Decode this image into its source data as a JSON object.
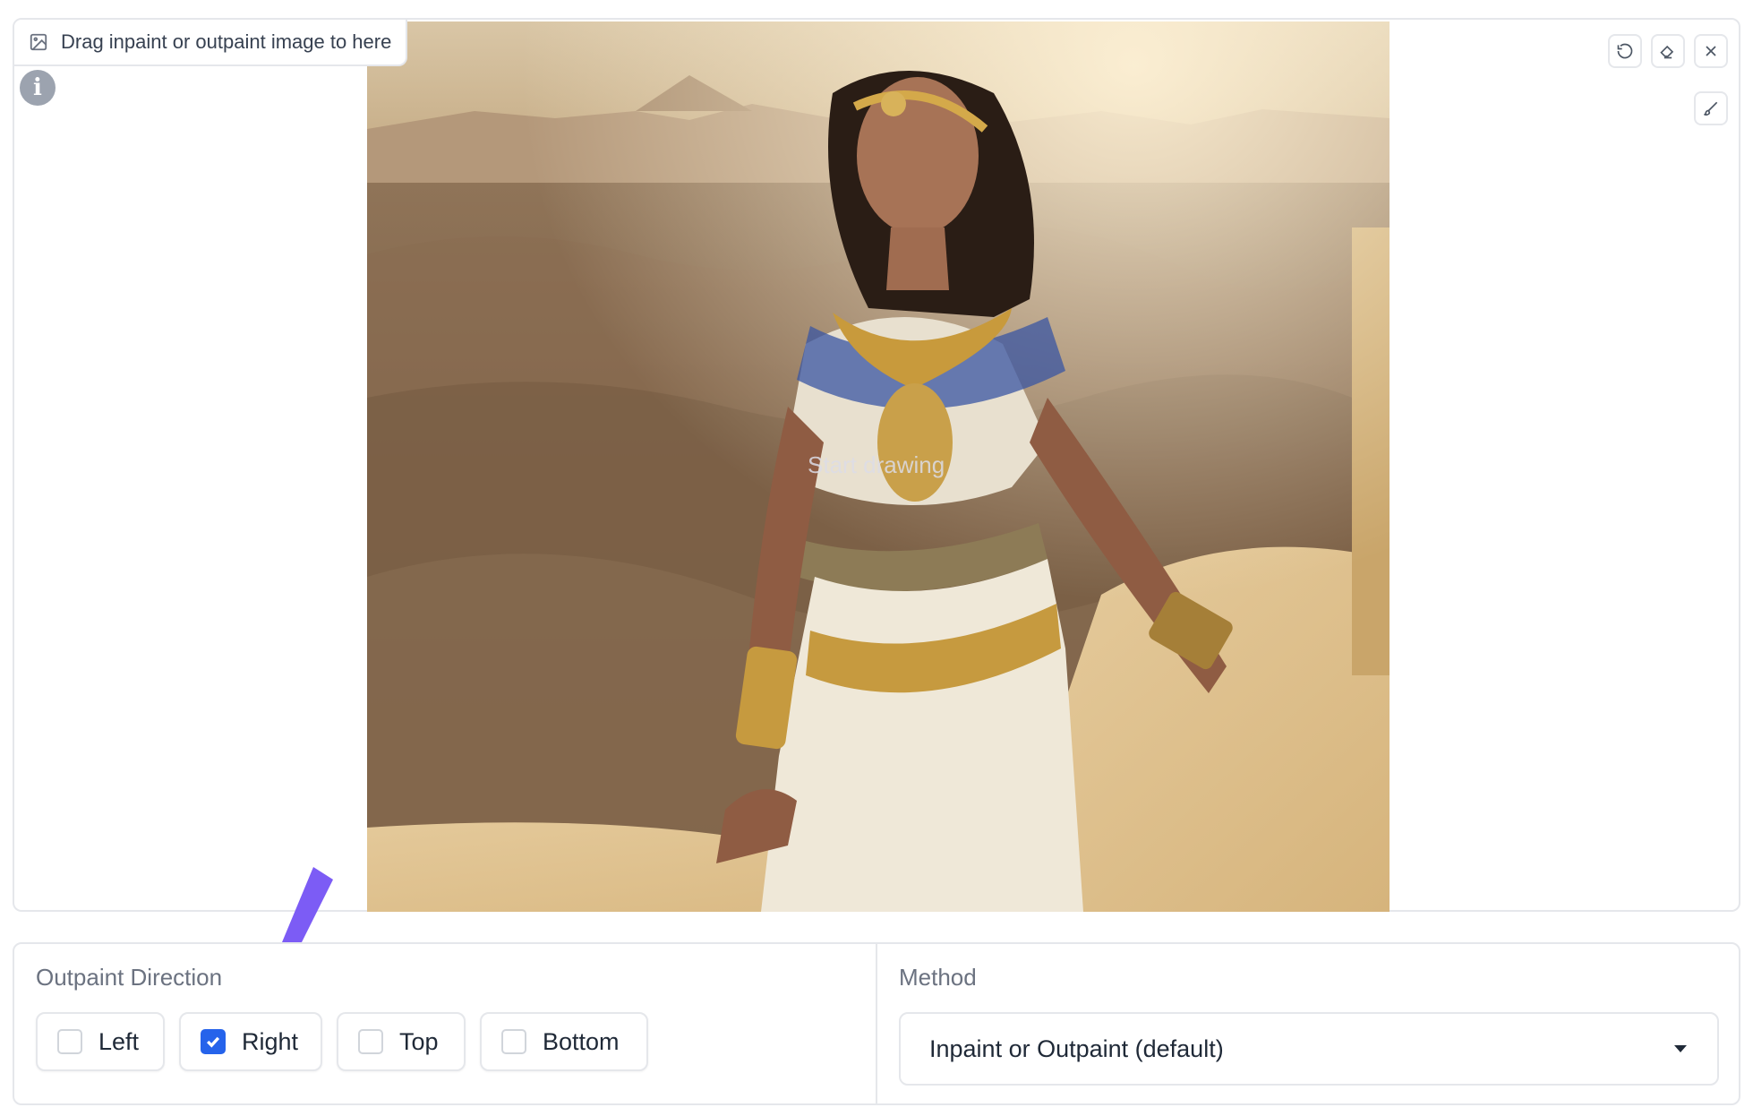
{
  "editor": {
    "drop_label": "Drag inpaint or outpaint image to here",
    "placeholder_text": "Start drawing",
    "icons": [
      "image-icon",
      "info-icon",
      "undo-icon",
      "eraser-icon",
      "close-icon",
      "brush-icon"
    ]
  },
  "outpaint": {
    "label": "Outpaint Direction",
    "options": [
      {
        "label": "Left",
        "checked": false
      },
      {
        "label": "Right",
        "checked": true
      },
      {
        "label": "Top",
        "checked": false
      },
      {
        "label": "Bottom",
        "checked": false
      }
    ]
  },
  "method": {
    "label": "Method",
    "selected": "Inpaint or Outpaint (default)"
  },
  "colors": {
    "accent": "#2563eb",
    "annotation_arrow": "#7c5cf5"
  }
}
